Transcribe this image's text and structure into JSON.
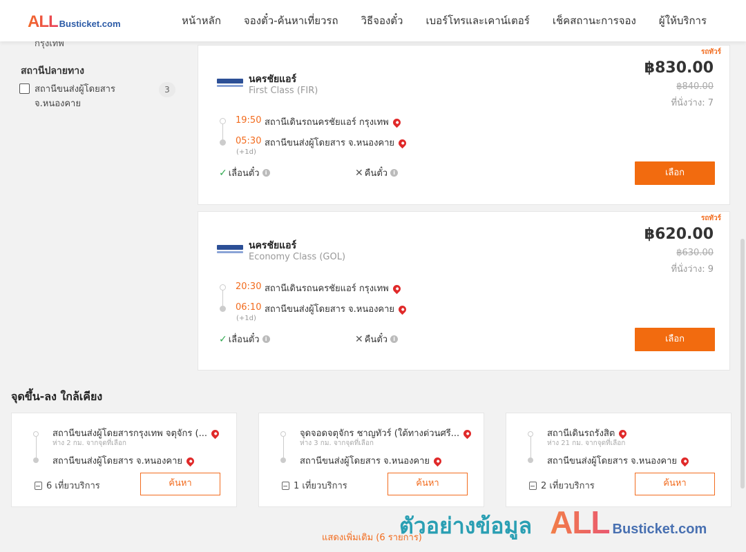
{
  "header": {
    "logo_all": "ALL",
    "logo_site": "Busticket.com",
    "nav": [
      "หน้าหลัก",
      "จองตั๋ว-ค้นหาเที่ยวรถ",
      "วิธีจองตั๋ว",
      "เบอร์โทรและเคาน์เตอร์",
      "เช็คสถานะการจอง",
      "ผู้ให้บริการ"
    ]
  },
  "sidebar": {
    "cut_text": "กรุงเทพ",
    "destination_title": "สถานีปลายทาง",
    "destination_option": {
      "label": "สถานีขนส่งผู้โดยสาร จ.หนองคาย",
      "count": "3",
      "checked": false
    }
  },
  "trips": [
    {
      "tag": "รถทัวร์",
      "operator": "นครชัยแอร์",
      "class": "First Class (FIR)",
      "price": "฿830.00",
      "old_price": "฿840.00",
      "seats": "ที่นั่งว่าง: 7",
      "depart_time": "19:50",
      "depart_station": "สถานีเดินรถนครชัยแอร์ กรุงเทพ",
      "arrive_time": "05:30",
      "arrive_station": "สถานีขนส่งผู้โดยสาร จ.หนองคาย",
      "next_day": "(+1d)",
      "reschedule": "เลื่อนตั๋ว",
      "refund": "คืนตั๋ว",
      "select_label": "เลือก"
    },
    {
      "tag": "รถทัวร์",
      "operator": "นครชัยแอร์",
      "class": "Economy Class (GOL)",
      "price": "฿620.00",
      "old_price": "฿630.00",
      "seats": "ที่นั่งว่าง: 9",
      "depart_time": "20:30",
      "depart_station": "สถานีเดินรถนครชัยแอร์ กรุงเทพ",
      "arrive_time": "06:10",
      "arrive_station": "สถานีขนส่งผู้โดยสาร จ.หนองคาย",
      "next_day": "(+1d)",
      "reschedule": "เลื่อนตั๋ว",
      "refund": "คืนตั๋ว",
      "select_label": "เลือก"
    }
  ],
  "nearby": {
    "title": "จุดขึ้น-ลง ใกล้เคียง",
    "cards": [
      {
        "from": "สถานีขนส่งผู้โดยสารกรุงเทพ จตุจักร (...",
        "distance": "ห่าง 2 กม. จากจุดที่เลือก",
        "to": "สถานีขนส่งผู้โดยสาร จ.หนองคาย",
        "trips": "6 เที่ยวบริการ",
        "search_label": "ค้นหา"
      },
      {
        "from": "จุดจอดจตุจักร ชาญทัวร์ (ใต้ทางด่วนศรี...",
        "distance": "ห่าง 3 กม. จากจุดที่เลือก",
        "to": "สถานีขนส่งผู้โดยสาร จ.หนองคาย",
        "trips": "1 เที่ยวบริการ",
        "search_label": "ค้นหา"
      },
      {
        "from": "สถานีเดินรถรังสิต",
        "distance": "ห่าง 21 กม. จากจุดที่เลือก",
        "to": "สถานีขนส่งผู้โดยสาร จ.หนองคาย",
        "trips": "2 เที่ยวบริการ",
        "search_label": "ค้นหา"
      }
    ],
    "show_more": "แสดงเพิ่มเติม (6 รายการ)"
  },
  "watermark": {
    "text": "ตัวอย่างข้อมูล",
    "all": "ALL",
    "site": "Busticket.com"
  },
  "colors": {
    "accent": "#f26b0f",
    "brand_blue": "#2b5aa6",
    "pin": "#e02a2a",
    "check": "#2fa84f"
  }
}
